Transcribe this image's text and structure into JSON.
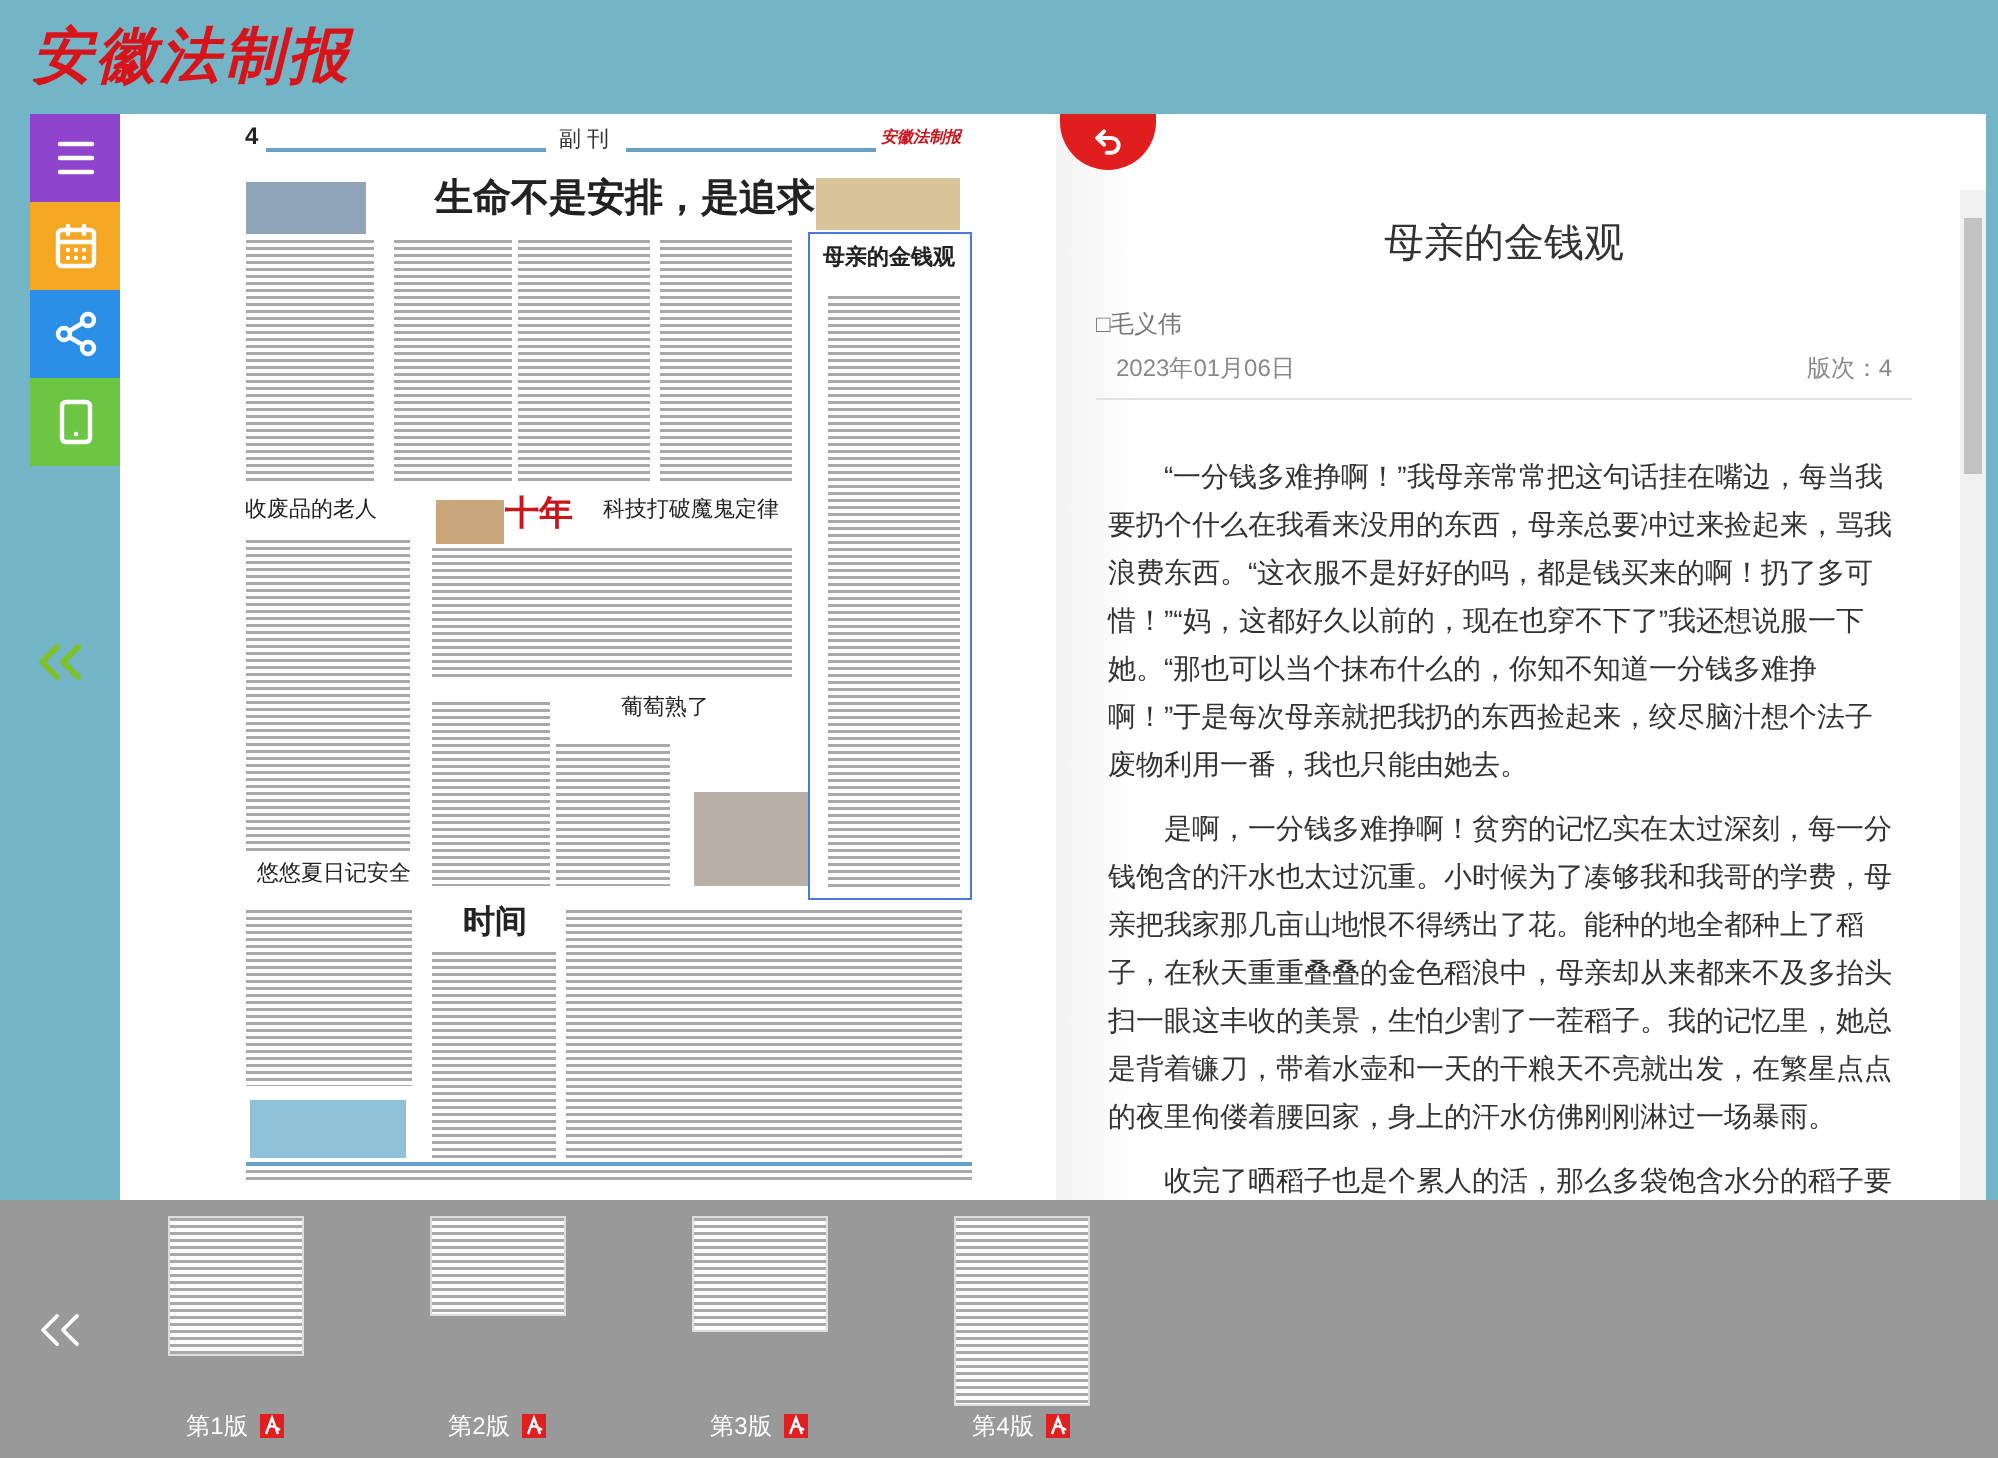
{
  "header": {
    "logo": "安徽法制报"
  },
  "side_toolbar": [
    {
      "kind": "menu",
      "color": "#8e44cc"
    },
    {
      "kind": "calendar",
      "color": "#f5a623"
    },
    {
      "kind": "share",
      "color": "#2b8fe8"
    },
    {
      "kind": "mobile",
      "color": "#6cc644"
    }
  ],
  "newspaper_page": {
    "page_number": "4",
    "section": "副 刊",
    "masthead": "安徽法制报",
    "headlines": [
      "生命不是安排，是追求",
      "收废品的老人",
      "十年",
      "科技打破魔鬼定律",
      "葡萄熟了",
      "悠悠夏日记安全",
      "时间"
    ],
    "highlighted_article": {
      "headline": "母亲的金钱观"
    }
  },
  "article": {
    "title": "母亲的金钱观",
    "author": "□毛义伟",
    "date": "2023年01月06日",
    "edition": "版次：4",
    "paragraphs": [
      "“一分钱多难挣啊！”我母亲常常把这句话挂在嘴边，每当我要扔个什么在我看来没用的东西，母亲总要冲过来捡起来，骂我浪费东西。“这衣服不是好好的吗，都是钱买来的啊！扔了多可惜！”“妈，这都好久以前的，现在也穿不下了”我还想说服一下她。“那也可以当个抹布什么的，你知不知道一分钱多难挣啊！”于是每次母亲就把我扔的东西捡起来，绞尽脑汁想个法子废物利用一番，我也只能由她去。",
      "是啊，一分钱多难挣啊！贫穷的记忆实在太过深刻，每一分钱饱含的汗水也太过沉重。小时候为了凑够我和我哥的学费，母亲把我家那几亩山地恨不得绣出了花。能种的地全都种上了稻子，在秋天重重叠叠的金色稻浪中，母亲却从来都来不及多抬头扫一眼这丰收的美景，生怕少割了一茬稻子。我的记忆里，她总是背着镰刀，带着水壶和一天的干粮天不亮就出发，在繁星点点的夜里佝偻着腰回家，身上的汗水仿佛刚刚淋过一场暴雨。",
      "收完了晒稻子也是个累人的活，那么多袋饱含水分的稻子要"
    ]
  },
  "pages": [
    {
      "label": "第1版"
    },
    {
      "label": "第2版"
    },
    {
      "label": "第3版"
    },
    {
      "label": "第4版"
    }
  ]
}
